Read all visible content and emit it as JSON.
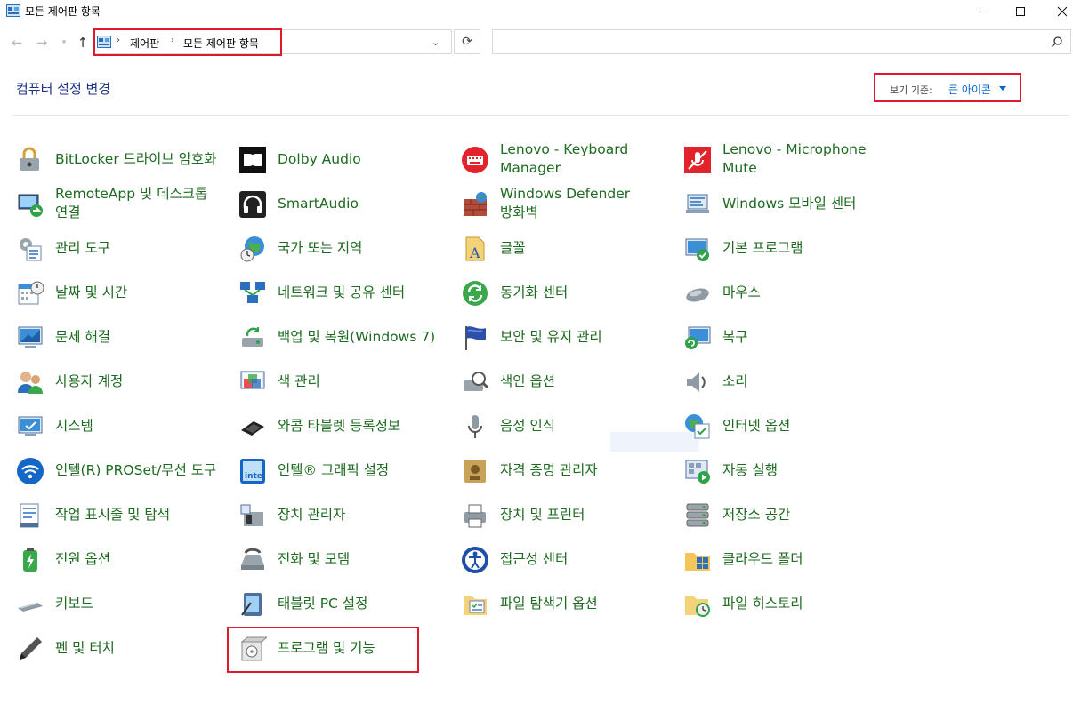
{
  "window": {
    "title": "모든 제어판 항목"
  },
  "address": {
    "crumbs": [
      "제어판",
      "모든 제어판 항목"
    ]
  },
  "search": {
    "placeholder": ""
  },
  "header": {
    "title": "컴퓨터 설정 변경",
    "view_by_label": "보기 기준:",
    "view_by_value": "큰 아이콘"
  },
  "items": [
    {
      "label": "BitLocker 드라이브 암호화",
      "icon": "bitlocker-icon"
    },
    {
      "label": "Dolby Audio",
      "icon": "dolby-icon"
    },
    {
      "label": "Lenovo - Keyboard Manager",
      "icon": "keyboard-manager-icon"
    },
    {
      "label": "Lenovo - Microphone Mute",
      "icon": "microphone-mute-icon"
    },
    {
      "label": "RemoteApp 및 데스크톱 연결",
      "icon": "remoteapp-icon"
    },
    {
      "label": "SmartAudio",
      "icon": "headphones-icon"
    },
    {
      "label": "Windows Defender 방화벽",
      "icon": "firewall-icon"
    },
    {
      "label": "Windows 모바일 센터",
      "icon": "mobility-center-icon"
    },
    {
      "label": "관리 도구",
      "icon": "admin-tools-icon"
    },
    {
      "label": "국가 또는 지역",
      "icon": "region-icon"
    },
    {
      "label": "글꼴",
      "icon": "fonts-icon"
    },
    {
      "label": "기본 프로그램",
      "icon": "default-programs-icon"
    },
    {
      "label": "날짜 및 시간",
      "icon": "date-time-icon"
    },
    {
      "label": "네트워크 및 공유 센터",
      "icon": "network-icon"
    },
    {
      "label": "동기화 센터",
      "icon": "sync-icon"
    },
    {
      "label": "마우스",
      "icon": "mouse-icon"
    },
    {
      "label": "문제 해결",
      "icon": "troubleshoot-icon"
    },
    {
      "label": "백업 및 복원(Windows 7)",
      "icon": "backup-icon"
    },
    {
      "label": "보안 및 유지 관리",
      "icon": "security-flag-icon"
    },
    {
      "label": "복구",
      "icon": "recovery-icon"
    },
    {
      "label": "사용자 계정",
      "icon": "user-accounts-icon"
    },
    {
      "label": "색 관리",
      "icon": "color-management-icon"
    },
    {
      "label": "색인 옵션",
      "icon": "indexing-icon"
    },
    {
      "label": "소리",
      "icon": "sound-icon"
    },
    {
      "label": "시스템",
      "icon": "system-icon"
    },
    {
      "label": "와콤 타블렛 등록정보",
      "icon": "wacom-icon"
    },
    {
      "label": "음성 인식",
      "icon": "speech-icon"
    },
    {
      "label": "인터넷 옵션",
      "icon": "internet-options-icon"
    },
    {
      "label": "인텔(R) PROSet/무선 도구",
      "icon": "wireless-icon"
    },
    {
      "label": "인텔® 그래픽 설정",
      "icon": "intel-graphics-icon"
    },
    {
      "label": "자격 증명 관리자",
      "icon": "credential-icon"
    },
    {
      "label": "자동 실행",
      "icon": "autoplay-icon"
    },
    {
      "label": "작업 표시줄 및 탐색",
      "icon": "taskbar-icon"
    },
    {
      "label": "장치 관리자",
      "icon": "device-manager-icon"
    },
    {
      "label": "장치 및 프린터",
      "icon": "printer-icon"
    },
    {
      "label": "저장소 공간",
      "icon": "storage-spaces-icon"
    },
    {
      "label": "전원 옵션",
      "icon": "power-icon"
    },
    {
      "label": "전화 및 모뎀",
      "icon": "phone-modem-icon"
    },
    {
      "label": "접근성 센터",
      "icon": "ease-of-access-icon"
    },
    {
      "label": "클라우드 폴더",
      "icon": "cloud-folder-icon"
    },
    {
      "label": "키보드",
      "icon": "keyboard-icon"
    },
    {
      "label": "태블릿 PC 설정",
      "icon": "tablet-icon"
    },
    {
      "label": "파일 탐색기 옵션",
      "icon": "folder-options-icon"
    },
    {
      "label": "파일 히스토리",
      "icon": "file-history-icon"
    },
    {
      "label": "펜 및 터치",
      "icon": "pen-icon"
    },
    {
      "label": "프로그램 및 기능",
      "icon": "programs-features-icon"
    }
  ],
  "colors": {
    "link": "#1d6a20",
    "title": "#1e3287",
    "accent": "#0066cc",
    "highlight": "#e0182a"
  }
}
